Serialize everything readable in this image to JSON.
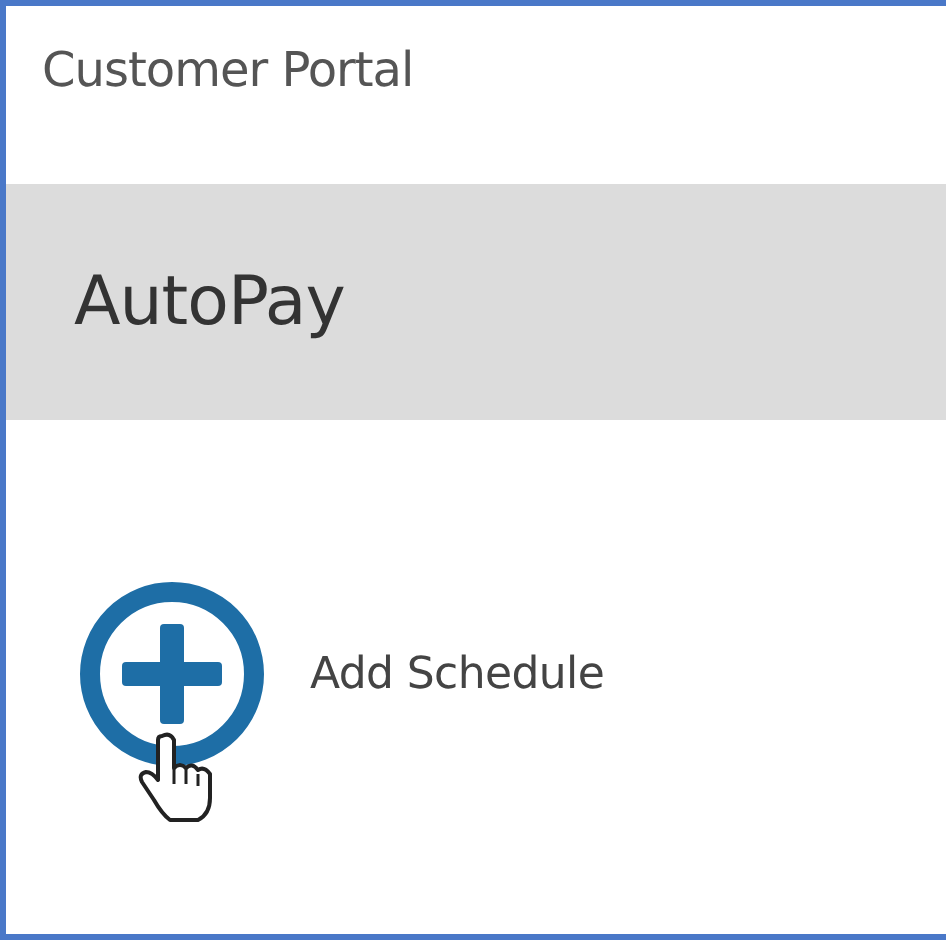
{
  "header": {
    "title": "Customer Portal"
  },
  "section": {
    "title": "AutoPay"
  },
  "action": {
    "label": "Add Schedule"
  }
}
